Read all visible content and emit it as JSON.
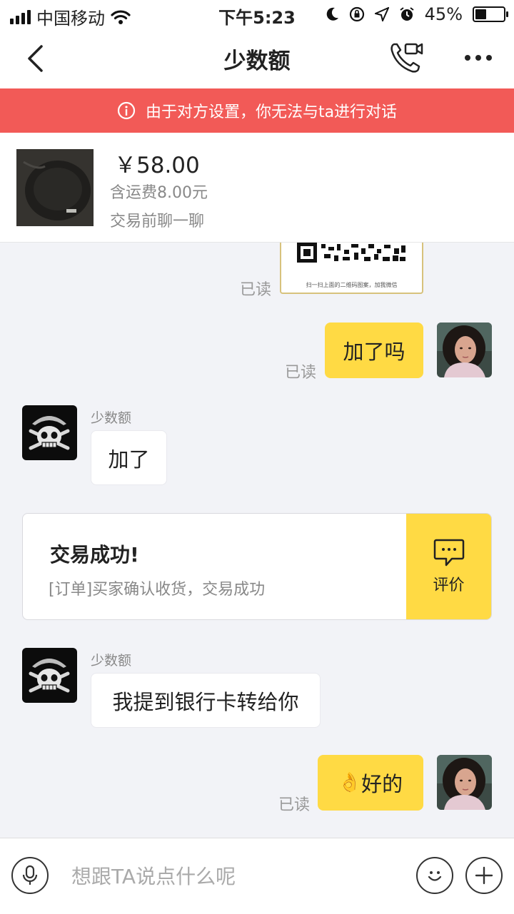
{
  "status_bar": {
    "carrier": "中国移动",
    "time": "下午5:23",
    "battery_pct": "45%",
    "battery_level": 0.45
  },
  "nav": {
    "title": "少数额"
  },
  "banner": {
    "text": "由于对方设置，你无法与ta进行对话",
    "color": "#f25a57"
  },
  "product": {
    "price": "￥58.00",
    "shipping": "含运费8.00元",
    "cta": "交易前聊一聊"
  },
  "messages": {
    "qr_caption": "扫一扫上面的二维码图案，加我微信",
    "qr_read": "已读",
    "msg1_text": "加了吗",
    "msg1_read": "已读",
    "msg2_sender": "少数额",
    "msg2_text": "加了",
    "trade_title": "交易成功!",
    "trade_desc": "[订单]买家确认收货，交易成功",
    "trade_action": "评价",
    "msg3_sender": "少数额",
    "msg3_text": "我提到银行卡转给你",
    "msg4_emoji": "👌",
    "msg4_text": "好的",
    "msg4_read": "已读"
  },
  "input": {
    "placeholder": "想跟TA说点什么呢"
  },
  "colors": {
    "accent": "#ffda44",
    "background": "#f2f3f7"
  },
  "icons": [
    "back-icon",
    "video-call-icon",
    "more-icon",
    "info-icon",
    "chat-icon",
    "microphone-icon",
    "emoji-icon",
    "plus-icon"
  ]
}
